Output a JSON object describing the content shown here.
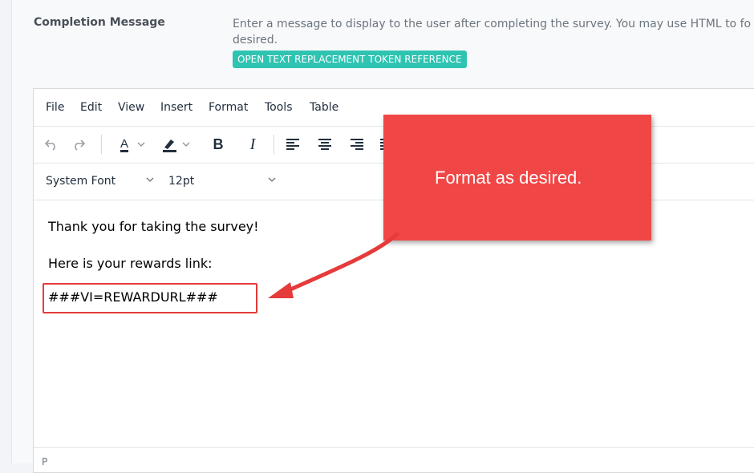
{
  "field": {
    "label": "Completion Message",
    "help_line1": "Enter a message to display to the user after completing the survey. You may use HTML to fo",
    "help_line2": "desired.",
    "token_button": "OPEN TEXT REPLACEMENT TOKEN REFERENCE"
  },
  "editor": {
    "menu": [
      "File",
      "Edit",
      "View",
      "Insert",
      "Format",
      "Tools",
      "Table"
    ],
    "toolbar": {
      "text_color_letter": "A",
      "bold": "B",
      "italic": "I"
    },
    "font_family": "System Font",
    "font_size": "12pt",
    "content": {
      "line1": "Thank you for taking the survey!",
      "line2": "Here is your rewards link:",
      "line3": "###VI=REWARDURL###"
    },
    "status_path": "P"
  },
  "annotation": {
    "callout_text": "Format as desired.",
    "callout_color": "#f14646",
    "highlight_color": "#e53b3b"
  },
  "colors": {
    "accent_teal": "#2fc4b2",
    "icon_dark": "#222f3e"
  }
}
